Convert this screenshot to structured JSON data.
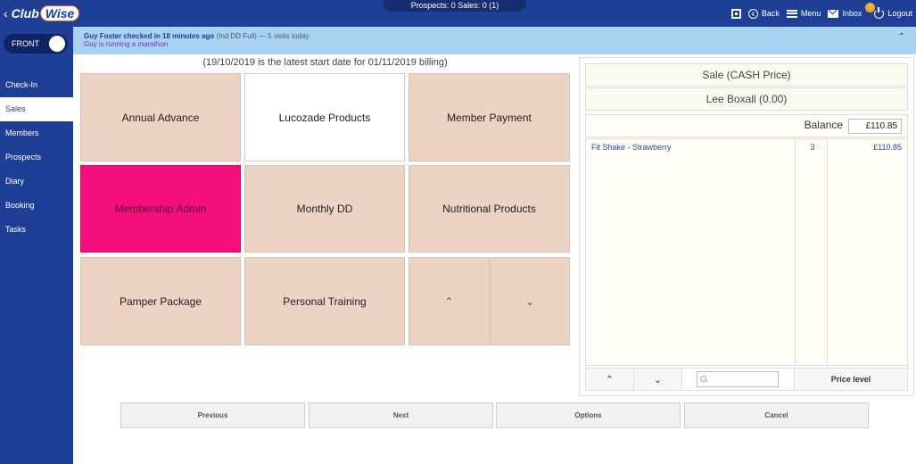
{
  "topbar": {
    "logo_club": "Club",
    "logo_wise": "Wise",
    "center_status": "Prospects: 0   Sales: 0   (1)",
    "back_label": "Back",
    "menu_label": "Menu",
    "inbox_label": "Inbox",
    "inbox_count": "0",
    "logout_label": "Logout"
  },
  "sidebar": {
    "toggle_label": "FRONT",
    "items": [
      {
        "label": "Check-In"
      },
      {
        "label": "Sales"
      },
      {
        "label": "Members"
      },
      {
        "label": "Prospects"
      },
      {
        "label": "Diary"
      },
      {
        "label": "Booking"
      },
      {
        "label": "Tasks"
      }
    ],
    "active_index": 1
  },
  "notification": {
    "name_checked": "Guy Foster checked in 18 minutes ago",
    "details": "(Ind DD Full) — 5 visits today",
    "note": "Guy is running a marathon"
  },
  "info_line": "(19/10/2019 is the latest start date for 01/11/2019 billing)",
  "tiles": [
    {
      "label": "Annual Advance"
    },
    {
      "label": "Lucozade Products"
    },
    {
      "label": "Member Payment"
    },
    {
      "label": "Membership Admin"
    },
    {
      "label": "Monthly DD"
    },
    {
      "label": "Nutritional Products"
    },
    {
      "label": "Pamper Package"
    },
    {
      "label": "Personal Training"
    }
  ],
  "panel": {
    "sale_type": "Sale (CASH Price)",
    "customer": "Lee Boxall (0.00)",
    "balance_label": "Balance",
    "balance_value": "£110.85",
    "lines": [
      {
        "name": "Fit Shake - Strawberry",
        "qty": "3",
        "price": "£110.85"
      }
    ],
    "search_placeholder": "",
    "price_level_label": "Price level"
  },
  "actions": {
    "previous": "Previous",
    "next": "Next",
    "options": "Options",
    "cancel": "Cancel"
  },
  "colors": {
    "brand_blue": "#1f3f96",
    "tile_beige": "#ecd3c4",
    "tile_highlight": "#f50f7d",
    "notif_blue": "#a8d2f0"
  }
}
